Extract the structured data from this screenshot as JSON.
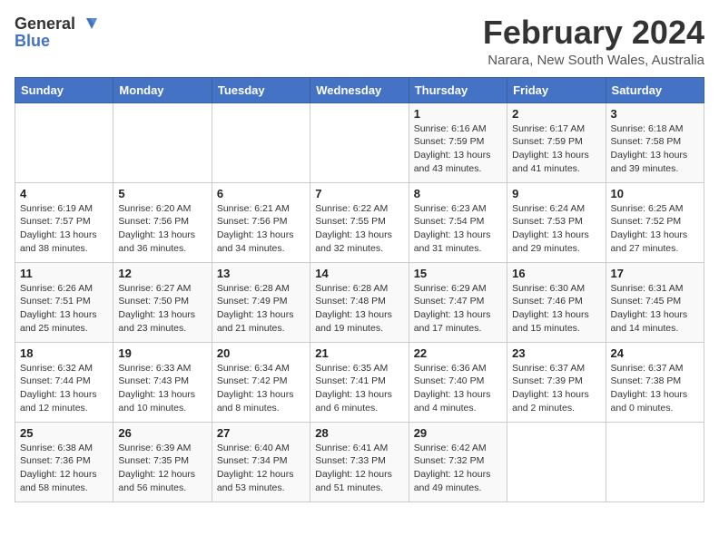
{
  "header": {
    "logo_general": "General",
    "logo_blue": "Blue",
    "title": "February 2024",
    "subtitle": "Narara, New South Wales, Australia"
  },
  "days_of_week": [
    "Sunday",
    "Monday",
    "Tuesday",
    "Wednesday",
    "Thursday",
    "Friday",
    "Saturday"
  ],
  "weeks": [
    [
      {
        "day": "",
        "info": ""
      },
      {
        "day": "",
        "info": ""
      },
      {
        "day": "",
        "info": ""
      },
      {
        "day": "",
        "info": ""
      },
      {
        "day": "1",
        "info": "Sunrise: 6:16 AM\nSunset: 7:59 PM\nDaylight: 13 hours and 43 minutes."
      },
      {
        "day": "2",
        "info": "Sunrise: 6:17 AM\nSunset: 7:59 PM\nDaylight: 13 hours and 41 minutes."
      },
      {
        "day": "3",
        "info": "Sunrise: 6:18 AM\nSunset: 7:58 PM\nDaylight: 13 hours and 39 minutes."
      }
    ],
    [
      {
        "day": "4",
        "info": "Sunrise: 6:19 AM\nSunset: 7:57 PM\nDaylight: 13 hours and 38 minutes."
      },
      {
        "day": "5",
        "info": "Sunrise: 6:20 AM\nSunset: 7:56 PM\nDaylight: 13 hours and 36 minutes."
      },
      {
        "day": "6",
        "info": "Sunrise: 6:21 AM\nSunset: 7:56 PM\nDaylight: 13 hours and 34 minutes."
      },
      {
        "day": "7",
        "info": "Sunrise: 6:22 AM\nSunset: 7:55 PM\nDaylight: 13 hours and 32 minutes."
      },
      {
        "day": "8",
        "info": "Sunrise: 6:23 AM\nSunset: 7:54 PM\nDaylight: 13 hours and 31 minutes."
      },
      {
        "day": "9",
        "info": "Sunrise: 6:24 AM\nSunset: 7:53 PM\nDaylight: 13 hours and 29 minutes."
      },
      {
        "day": "10",
        "info": "Sunrise: 6:25 AM\nSunset: 7:52 PM\nDaylight: 13 hours and 27 minutes."
      }
    ],
    [
      {
        "day": "11",
        "info": "Sunrise: 6:26 AM\nSunset: 7:51 PM\nDaylight: 13 hours and 25 minutes."
      },
      {
        "day": "12",
        "info": "Sunrise: 6:27 AM\nSunset: 7:50 PM\nDaylight: 13 hours and 23 minutes."
      },
      {
        "day": "13",
        "info": "Sunrise: 6:28 AM\nSunset: 7:49 PM\nDaylight: 13 hours and 21 minutes."
      },
      {
        "day": "14",
        "info": "Sunrise: 6:28 AM\nSunset: 7:48 PM\nDaylight: 13 hours and 19 minutes."
      },
      {
        "day": "15",
        "info": "Sunrise: 6:29 AM\nSunset: 7:47 PM\nDaylight: 13 hours and 17 minutes."
      },
      {
        "day": "16",
        "info": "Sunrise: 6:30 AM\nSunset: 7:46 PM\nDaylight: 13 hours and 15 minutes."
      },
      {
        "day": "17",
        "info": "Sunrise: 6:31 AM\nSunset: 7:45 PM\nDaylight: 13 hours and 14 minutes."
      }
    ],
    [
      {
        "day": "18",
        "info": "Sunrise: 6:32 AM\nSunset: 7:44 PM\nDaylight: 13 hours and 12 minutes."
      },
      {
        "day": "19",
        "info": "Sunrise: 6:33 AM\nSunset: 7:43 PM\nDaylight: 13 hours and 10 minutes."
      },
      {
        "day": "20",
        "info": "Sunrise: 6:34 AM\nSunset: 7:42 PM\nDaylight: 13 hours and 8 minutes."
      },
      {
        "day": "21",
        "info": "Sunrise: 6:35 AM\nSunset: 7:41 PM\nDaylight: 13 hours and 6 minutes."
      },
      {
        "day": "22",
        "info": "Sunrise: 6:36 AM\nSunset: 7:40 PM\nDaylight: 13 hours and 4 minutes."
      },
      {
        "day": "23",
        "info": "Sunrise: 6:37 AM\nSunset: 7:39 PM\nDaylight: 13 hours and 2 minutes."
      },
      {
        "day": "24",
        "info": "Sunrise: 6:37 AM\nSunset: 7:38 PM\nDaylight: 13 hours and 0 minutes."
      }
    ],
    [
      {
        "day": "25",
        "info": "Sunrise: 6:38 AM\nSunset: 7:36 PM\nDaylight: 12 hours and 58 minutes."
      },
      {
        "day": "26",
        "info": "Sunrise: 6:39 AM\nSunset: 7:35 PM\nDaylight: 12 hours and 56 minutes."
      },
      {
        "day": "27",
        "info": "Sunrise: 6:40 AM\nSunset: 7:34 PM\nDaylight: 12 hours and 53 minutes."
      },
      {
        "day": "28",
        "info": "Sunrise: 6:41 AM\nSunset: 7:33 PM\nDaylight: 12 hours and 51 minutes."
      },
      {
        "day": "29",
        "info": "Sunrise: 6:42 AM\nSunset: 7:32 PM\nDaylight: 12 hours and 49 minutes."
      },
      {
        "day": "",
        "info": ""
      },
      {
        "day": "",
        "info": ""
      }
    ]
  ]
}
